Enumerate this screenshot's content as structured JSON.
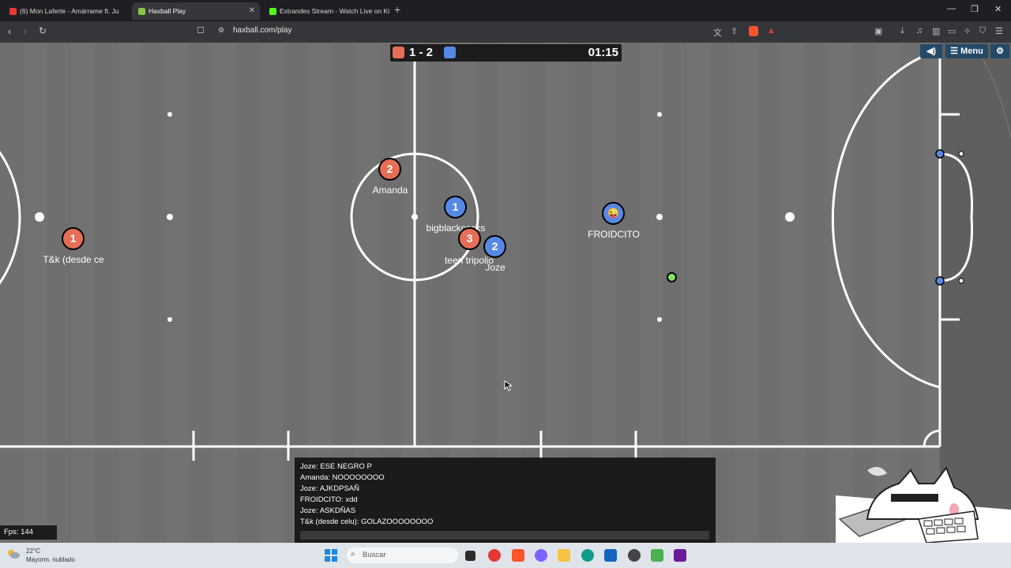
{
  "browser": {
    "tabs": [
      {
        "title": "(6) Mon Laferte - Amárrame ft. Ju",
        "active": false
      },
      {
        "title": "Haxball Play",
        "active": true
      },
      {
        "title": "Extrandes Stream - Watch Live on Kic",
        "active": false
      }
    ],
    "url": "haxball.com/play"
  },
  "game": {
    "score": "1 - 2",
    "timer": "01:15",
    "menu": {
      "sound_icon": "speaker-icon",
      "menu_label": "Menu",
      "settings_icon": "gear-icon"
    },
    "players": [
      {
        "number": "1",
        "team": "red",
        "name": "T&k (desde ce"
      },
      {
        "number": "2",
        "team": "red",
        "name": "Amanda"
      },
      {
        "number": "1",
        "team": "blue",
        "name": "bigblackcocks"
      },
      {
        "number": "3",
        "team": "red",
        "name": "teen tripolio"
      },
      {
        "number": "2",
        "team": "blue",
        "name": "Joze"
      },
      {
        "number": "😜",
        "team": "blue",
        "name": "FROIDCITO"
      }
    ],
    "chat": [
      "Joze: ESE NEGRO P",
      "Amanda: NOOOOOOOO",
      "Joze: AJKDPSAÑ",
      "FROIDCITO: xdd",
      "Joze: ASKDÑAS",
      "T&k (desde celu): GOLAZOOOOOOOO"
    ],
    "fps": "Fps: 144",
    "colors": {
      "red": "#e56e56",
      "blue": "#5689e5",
      "ball": "#7fe561",
      "pitch": "#6f6f6f"
    }
  },
  "taskbar": {
    "weather_temp": "22°C",
    "weather_desc": "Mayorm. nublado",
    "search_placeholder": "Buscar"
  }
}
